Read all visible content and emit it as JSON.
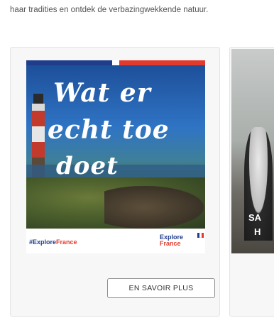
{
  "intro_text": "haar tradities en ontdek de verbazingwekkende natuur.",
  "card_main": {
    "poster_script": {
      "line1": "Wat er",
      "line2": "echt toe",
      "line3": "doet"
    },
    "hashtag_part1": "#Explore",
    "hashtag_part2": "France",
    "brand_part1": "Explore",
    "brand_part2": "France",
    "cta_label": "EN SAVOIR PLUS"
  },
  "card_next": {
    "overlay_line1": "SA",
    "overlay_line2": "H"
  },
  "colors": {
    "france_blue": "#1f3d8a",
    "france_red": "#e23b2e",
    "white": "#ffffff",
    "card_bg": "#f7f7f7"
  }
}
